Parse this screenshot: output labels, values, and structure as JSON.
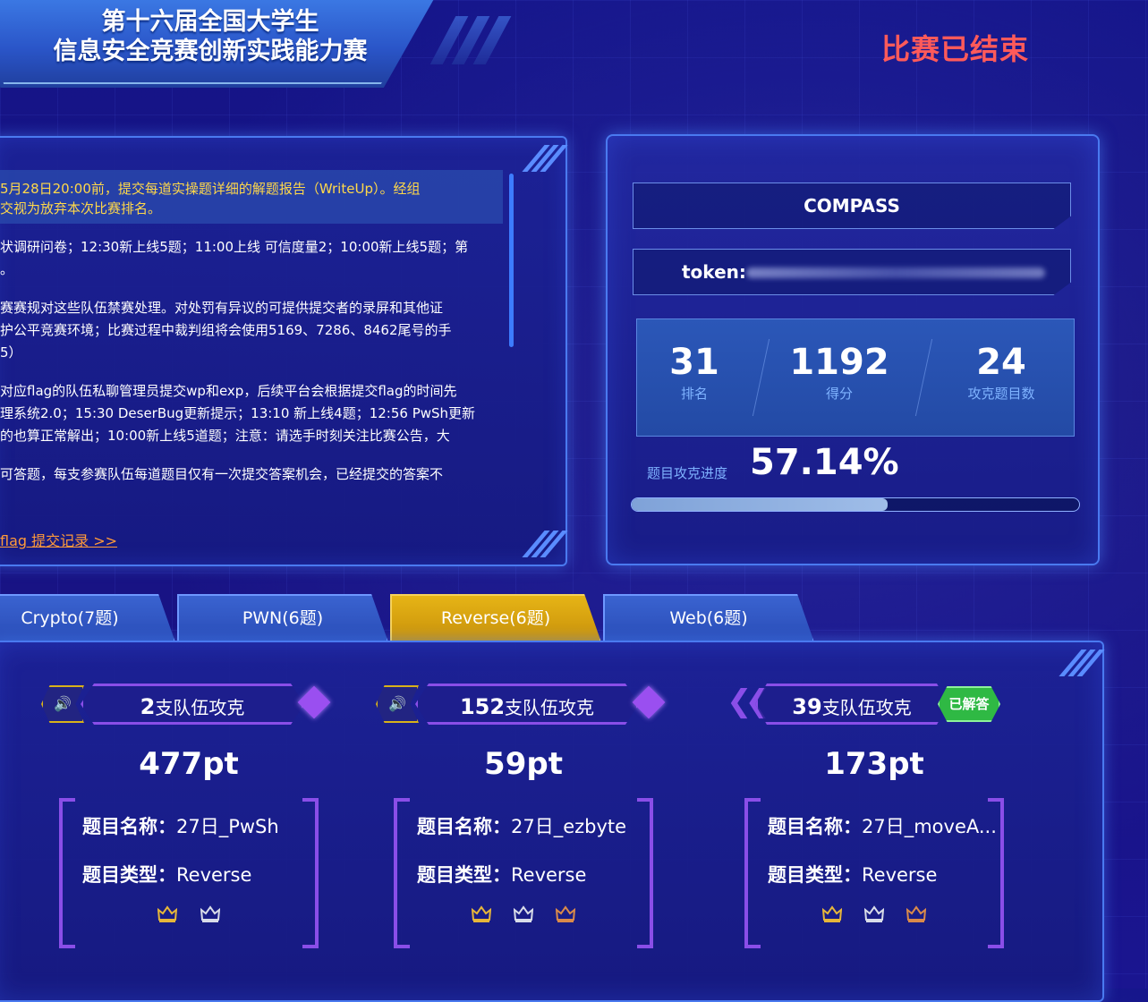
{
  "header": {
    "title_line1": "第十六届全国大学生",
    "title_line2": "信息安全竞赛创新实践能力赛",
    "status": "比赛已结束"
  },
  "notice": {
    "highlight_line1": "5月28日20:00前，提交每道实操题详细的解题报告（WriteUp）。经组",
    "highlight_line2": "交视为放弃本次比赛排名。",
    "para1_line1": "状调研问卷；12:30新上线5题；11:00上线 可信度量2；10:00新上线5题；第",
    "para1_line2": "。",
    "para2_line1": "赛赛规对这些队伍禁赛处理。对处罚有异议的可提供提交者的录屏和其他证",
    "para2_line2": "护公平竞赛环境；比赛过程中裁判组将会使用5169、7286、8462尾号的手",
    "para2_line3": "5）",
    "para3_line1": "对应flag的队伍私聊管理员提交wp和exp，后续平台会根据提交flag的时间先",
    "para3_line2": "理系统2.0；15:30 DeserBug更新提示；13:10 新上线4题；12:56 PwSh更新",
    "para3_line3": "的也算正常解出；10:00新上线5道题；注意：请选手时刻关注比赛公告，大",
    "para4_line1": "可答题，每支参赛队伍每道题目仅有一次提交答案机会，已经提交的答案不",
    "link": "flag 提交记录 >>"
  },
  "team": {
    "name": "COMPASS",
    "token_label": "token:",
    "rank": "31",
    "rank_label": "排名",
    "score": "1192",
    "score_label": "得分",
    "solved": "24",
    "solved_label": "攻克题目数",
    "progress_label": "题目攻克进度",
    "progress_text": "57.14%",
    "progress_value": 0.5714
  },
  "tabs": [
    {
      "label": "Crypto(7题)",
      "active": false
    },
    {
      "label": "PWN(6题)",
      "active": false
    },
    {
      "label": "Reverse(6题)",
      "active": true
    },
    {
      "label": "Web(6题)",
      "active": false
    }
  ],
  "challenges": [
    {
      "team_count": "2",
      "team_suffix": "支队伍攻克",
      "points": "477pt",
      "name_label": "题目名称：",
      "name": "27日_PwSh",
      "type_label": "题目类型：",
      "type": "Reverse",
      "crowns": 2,
      "solved": false
    },
    {
      "team_count": "152",
      "team_suffix": "支队伍攻克",
      "points": "59pt",
      "name_label": "题目名称：",
      "name": "27日_ezbyte",
      "type_label": "题目类型：",
      "type": "Reverse",
      "crowns": 3,
      "solved": false
    },
    {
      "team_count": "39",
      "team_suffix": "支队伍攻克",
      "points": "173pt",
      "name_label": "题目名称：",
      "name": "27日_moveA...",
      "type_label": "题目类型：",
      "type": "Reverse",
      "crowns": 3,
      "solved": true,
      "solved_label": "已解答"
    }
  ],
  "colors": {
    "accent": "#4a7af0",
    "active_tab": "#e6b416",
    "status_red": "#ff5a5a",
    "purple": "#8a4ee8",
    "gold_crown": "#e6b63a",
    "silver_crown": "#d8dce8",
    "bronze_crown": "#d98a4a",
    "solved_green": "#2fb944"
  }
}
